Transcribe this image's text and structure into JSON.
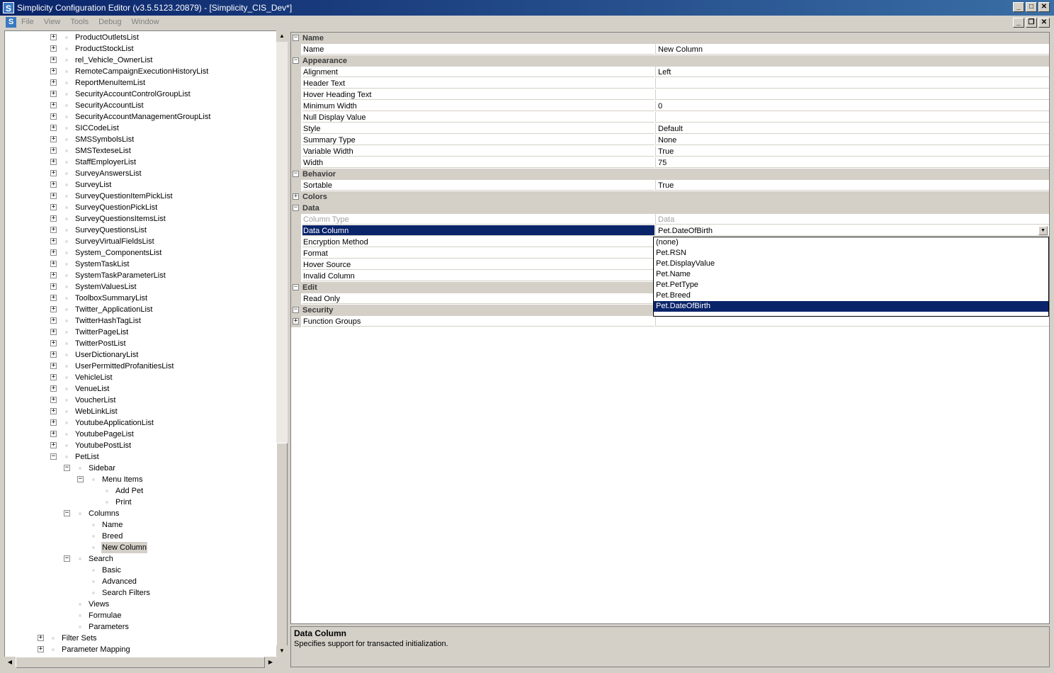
{
  "window": {
    "title": "Simplicity Configuration Editor (v3.5.5123.20879) - [Simplicity_CIS_Dev*]",
    "app_icon": "S"
  },
  "menubar": {
    "items": [
      "File",
      "View",
      "Tools",
      "Debug",
      "Window"
    ]
  },
  "tree": {
    "nodes": [
      {
        "label": "ProductOutletsList",
        "level": 0,
        "expander": "+"
      },
      {
        "label": "ProductStockList",
        "level": 0,
        "expander": "+"
      },
      {
        "label": "rel_Vehicle_OwnerList",
        "level": 0,
        "expander": "+"
      },
      {
        "label": "RemoteCampaignExecutionHistoryList",
        "level": 0,
        "expander": "+"
      },
      {
        "label": "ReportMenuItemList",
        "level": 0,
        "expander": "+"
      },
      {
        "label": "SecurityAccountControlGroupList",
        "level": 0,
        "expander": "+"
      },
      {
        "label": "SecurityAccountList",
        "level": 0,
        "expander": "+"
      },
      {
        "label": "SecurityAccountManagementGroupList",
        "level": 0,
        "expander": "+"
      },
      {
        "label": "SICCodeList",
        "level": 0,
        "expander": "+"
      },
      {
        "label": "SMSSymbolsList",
        "level": 0,
        "expander": "+"
      },
      {
        "label": "SMSTexteseList",
        "level": 0,
        "expander": "+"
      },
      {
        "label": "StaffEmployerList",
        "level": 0,
        "expander": "+"
      },
      {
        "label": "SurveyAnswersList",
        "level": 0,
        "expander": "+"
      },
      {
        "label": "SurveyList",
        "level": 0,
        "expander": "+"
      },
      {
        "label": "SurveyQuestionItemPickList",
        "level": 0,
        "expander": "+"
      },
      {
        "label": "SurveyQuestionPickList",
        "level": 0,
        "expander": "+"
      },
      {
        "label": "SurveyQuestionsItemsList",
        "level": 0,
        "expander": "+"
      },
      {
        "label": "SurveyQuestionsList",
        "level": 0,
        "expander": "+"
      },
      {
        "label": "SurveyVirtualFieldsList",
        "level": 0,
        "expander": "+"
      },
      {
        "label": "System_ComponentsList",
        "level": 0,
        "expander": "+"
      },
      {
        "label": "SystemTaskList",
        "level": 0,
        "expander": "+"
      },
      {
        "label": "SystemTaskParameterList",
        "level": 0,
        "expander": "+"
      },
      {
        "label": "SystemValuesList",
        "level": 0,
        "expander": "+"
      },
      {
        "label": "ToolboxSummaryList",
        "level": 0,
        "expander": "+"
      },
      {
        "label": "Twitter_ApplicationList",
        "level": 0,
        "expander": "+"
      },
      {
        "label": "TwitterHashTagList",
        "level": 0,
        "expander": "+"
      },
      {
        "label": "TwitterPageList",
        "level": 0,
        "expander": "+"
      },
      {
        "label": "TwitterPostList",
        "level": 0,
        "expander": "+"
      },
      {
        "label": "UserDictionaryList",
        "level": 0,
        "expander": "+"
      },
      {
        "label": "UserPermittedProfanitiesList",
        "level": 0,
        "expander": "+"
      },
      {
        "label": "VehicleList",
        "level": 0,
        "expander": "+"
      },
      {
        "label": "VenueList",
        "level": 0,
        "expander": "+"
      },
      {
        "label": "VoucherList",
        "level": 0,
        "expander": "+"
      },
      {
        "label": "WebLinkList",
        "level": 0,
        "expander": "+"
      },
      {
        "label": "YoutubeApplicationList",
        "level": 0,
        "expander": "+"
      },
      {
        "label": "YoutubePageList",
        "level": 0,
        "expander": "+"
      },
      {
        "label": "YoutubePostList",
        "level": 0,
        "expander": "+"
      },
      {
        "label": "PetList",
        "level": 0,
        "expander": "-"
      },
      {
        "label": "Sidebar",
        "level": 1,
        "expander": "-"
      },
      {
        "label": "Menu Items",
        "level": 2,
        "expander": "-"
      },
      {
        "label": "Add Pet",
        "level": 3,
        "expander": ""
      },
      {
        "label": "Print",
        "level": 3,
        "expander": ""
      },
      {
        "label": "Columns",
        "level": 1,
        "expander": "-"
      },
      {
        "label": "Name",
        "level": 2,
        "expander": ""
      },
      {
        "label": "Breed",
        "level": 2,
        "expander": ""
      },
      {
        "label": "New Column",
        "level": 2,
        "expander": "",
        "selected": true
      },
      {
        "label": "Search",
        "level": 1,
        "expander": "-"
      },
      {
        "label": "Basic",
        "level": 2,
        "expander": ""
      },
      {
        "label": "Advanced",
        "level": 2,
        "expander": ""
      },
      {
        "label": "Search Filters",
        "level": 2,
        "expander": ""
      },
      {
        "label": "Views",
        "level": 1,
        "expander": ""
      },
      {
        "label": "Formulae",
        "level": 1,
        "expander": ""
      },
      {
        "label": "Parameters",
        "level": 1,
        "expander": ""
      },
      {
        "label": "Filter Sets",
        "level": -1,
        "expander": "+"
      },
      {
        "label": "Parameter Mapping",
        "level": -1,
        "expander": "+"
      }
    ]
  },
  "properties": {
    "rows": [
      {
        "type": "cat",
        "label": "Name",
        "expander": "-"
      },
      {
        "type": "prop",
        "name": "Name",
        "value": "New Column"
      },
      {
        "type": "cat",
        "label": "Appearance",
        "expander": "-"
      },
      {
        "type": "prop",
        "name": "Alignment",
        "value": "Left"
      },
      {
        "type": "prop",
        "name": "Header Text",
        "value": ""
      },
      {
        "type": "prop",
        "name": "Hover Heading Text",
        "value": ""
      },
      {
        "type": "prop",
        "name": "Minimum Width",
        "value": "0"
      },
      {
        "type": "prop",
        "name": "Null Display Value",
        "value": ""
      },
      {
        "type": "prop",
        "name": "Style",
        "value": "Default"
      },
      {
        "type": "prop",
        "name": "Summary Type",
        "value": "None"
      },
      {
        "type": "prop",
        "name": "Variable Width",
        "value": "True"
      },
      {
        "type": "prop",
        "name": "Width",
        "value": "75"
      },
      {
        "type": "cat",
        "label": "Behavior",
        "expander": "-"
      },
      {
        "type": "prop",
        "name": "Sortable",
        "value": "True"
      },
      {
        "type": "cat",
        "label": "Colors",
        "expander": "+"
      },
      {
        "type": "cat",
        "label": "Data",
        "expander": "-"
      },
      {
        "type": "prop",
        "name": "Column Type",
        "value": "Data",
        "disabled": true
      },
      {
        "type": "prop",
        "name": "Data Column",
        "value": "Pet.DateOfBirth",
        "selected": true
      },
      {
        "type": "prop",
        "name": "Encryption Method",
        "value": ""
      },
      {
        "type": "prop",
        "name": "Format",
        "value": ""
      },
      {
        "type": "prop",
        "name": "Hover Source",
        "value": ""
      },
      {
        "type": "prop",
        "name": "Invalid Column",
        "value": ""
      },
      {
        "type": "cat",
        "label": "Edit",
        "expander": "-"
      },
      {
        "type": "prop",
        "name": "Read Only",
        "value": ""
      },
      {
        "type": "cat",
        "label": "Security",
        "expander": "-"
      },
      {
        "type": "prop",
        "name": "Function Groups",
        "value": "",
        "expander": "+"
      }
    ]
  },
  "dropdown": {
    "options": [
      "(none)",
      "Pet.RSN",
      "Pet.DisplayValue",
      "Pet.Name",
      "Pet.PetType",
      "Pet.Breed",
      "Pet.DateOfBirth"
    ],
    "selected_index": 6
  },
  "description": {
    "title": "Data Column",
    "text": "Specifies support for transacted initialization."
  },
  "colors": {
    "selection": "#0a246a",
    "chrome": "#d4d0c8"
  }
}
